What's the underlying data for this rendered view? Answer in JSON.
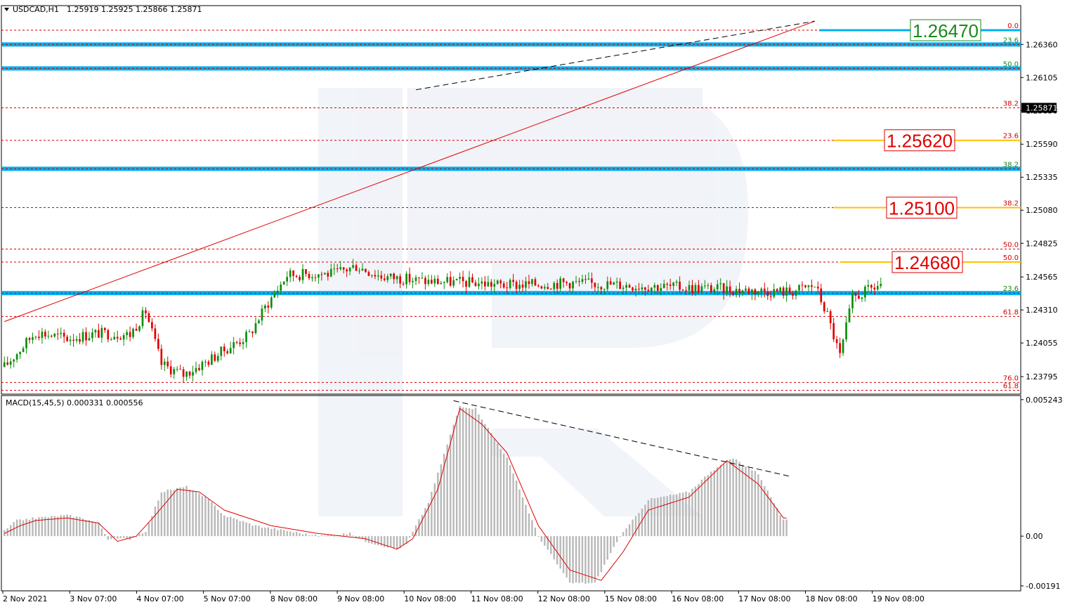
{
  "header": {
    "symbol": "USDCAD,H1",
    "ohlc": "1.25919 1.25925 1.25866 1.25871",
    "macd": "MACD(15,45,5) 0.000331 0.000556"
  },
  "colors": {
    "bull": "#0a8f0a",
    "bear": "#e00000",
    "support_band": "#00b0f0",
    "fib_line": "#d40000",
    "target_line": "#ffc000",
    "trend_red": "#e00000",
    "macd_hist": "#b8b8b8",
    "macd_signal": "#e00000"
  },
  "chart_data": [
    {
      "type": "candlestick",
      "title": "USDCAD,H1",
      "ylim": [
        1.2366,
        1.2666
      ],
      "y_ticks": [
        "1.26360",
        "1.26105",
        "1.25850",
        "1.25590",
        "1.25335",
        "1.25080",
        "1.24825",
        "1.24565",
        "1.24310",
        "1.24055",
        "1.23795"
      ],
      "last_price": "1.25871",
      "bars_total": 280,
      "close_path": [
        [
          0,
          1.2387
        ],
        [
          10,
          1.2414
        ],
        [
          20,
          1.2409
        ],
        [
          30,
          1.2413
        ],
        [
          40,
          1.2412
        ],
        [
          45,
          1.243
        ],
        [
          50,
          1.2389
        ],
        [
          57,
          1.2381
        ],
        [
          65,
          1.2392
        ],
        [
          70,
          1.24
        ],
        [
          78,
          1.2412
        ],
        [
          83,
          1.2433
        ],
        [
          90,
          1.2458
        ],
        [
          97,
          1.2459
        ],
        [
          105,
          1.2459
        ],
        [
          112,
          1.2465
        ],
        [
          120,
          1.2457
        ],
        [
          135,
          1.2453
        ],
        [
          150,
          1.2452
        ],
        [
          160,
          1.245
        ],
        [
          180,
          1.2452
        ],
        [
          200,
          1.245
        ],
        [
          220,
          1.2448
        ],
        [
          230,
          1.2447
        ],
        [
          250,
          1.2445
        ],
        [
          258,
          1.245
        ],
        [
          262,
          1.2427
        ],
        [
          266,
          1.2395
        ],
        [
          270,
          1.244
        ],
        [
          280,
          1.2452
        ]
      ],
      "levels": [
        {
          "label": "0.0",
          "value": 1.2647,
          "color": "red"
        },
        {
          "label": "23.6",
          "value": 1.2636,
          "color": "green",
          "band": true
        },
        {
          "label": "50.0",
          "value": 1.26175,
          "color": "green",
          "band": true
        },
        {
          "label": "38.2",
          "value": 1.25871,
          "color": "red"
        },
        {
          "label": "23.6",
          "value": 1.2562,
          "color": "red"
        },
        {
          "label": "38.2",
          "value": 1.254,
          "color": "green",
          "band": true
        },
        {
          "label": "38.2",
          "value": 1.251,
          "color": "red"
        },
        {
          "label": "50.0",
          "value": 1.2478,
          "color": "red"
        },
        {
          "label": "50.0",
          "value": 1.2468,
          "color": "red"
        },
        {
          "label": "23.6",
          "value": 1.2444,
          "color": "green",
          "band": true
        },
        {
          "label": "61.8",
          "value": 1.2426,
          "color": "red"
        },
        {
          "label": "76.0",
          "value": 1.2375,
          "color": "red"
        },
        {
          "label": "61.8",
          "value": 1.2369,
          "color": "red"
        }
      ],
      "targets": [
        {
          "label": "1.26470",
          "value": 1.2647,
          "color": "green"
        },
        {
          "label": "1.25620",
          "value": 1.2562,
          "color": "red"
        },
        {
          "label": "1.25100",
          "value": 1.251,
          "color": "red"
        },
        {
          "label": "1.24680",
          "value": 1.2468,
          "color": "red"
        }
      ],
      "trend_lines": [
        {
          "from": [
            0,
            1.2422
          ],
          "to": [
            258,
            1.2654
          ],
          "style": "solid",
          "color": "red"
        },
        {
          "from": [
            131,
            1.2601
          ],
          "to": [
            258,
            1.2654
          ],
          "style": "dashed",
          "color": "black"
        }
      ]
    },
    {
      "type": "histogram",
      "title": "MACD(15,45,5)",
      "ylim": [
        -0.0021,
        0.0054
      ],
      "y_ticks": [
        "0.005243",
        "0.00",
        "-0.00191"
      ],
      "hist_path": [
        [
          0,
          0.0002
        ],
        [
          4,
          0.0006
        ],
        [
          10,
          0.0007
        ],
        [
          20,
          0.0008
        ],
        [
          25,
          0.0007
        ],
        [
          30,
          0.0005
        ],
        [
          33,
          -0.0001
        ],
        [
          40,
          -0.0001
        ],
        [
          45,
          0.0002
        ],
        [
          50,
          0.0017
        ],
        [
          58,
          0.0019
        ],
        [
          65,
          0.0014
        ],
        [
          70,
          0.0008
        ],
        [
          80,
          0.0004
        ],
        [
          90,
          0.0002
        ],
        [
          100,
          0.0
        ],
        [
          110,
          0.0001
        ],
        [
          115,
          -0.0002
        ],
        [
          125,
          -0.0005
        ],
        [
          128,
          -0.0003
        ],
        [
          135,
          0.0013
        ],
        [
          145,
          0.005
        ],
        [
          150,
          0.0049
        ],
        [
          160,
          0.003
        ],
        [
          170,
          0.0
        ],
        [
          180,
          -0.0018
        ],
        [
          188,
          -0.0018
        ],
        [
          195,
          -0.0002
        ],
        [
          205,
          0.0014
        ],
        [
          218,
          0.0017
        ],
        [
          225,
          0.0025
        ],
        [
          232,
          0.003
        ],
        [
          240,
          0.0024
        ],
        [
          248,
          0.0006
        ]
      ],
      "signal_path": [
        [
          0,
          0.0001
        ],
        [
          5,
          0.0004
        ],
        [
          10,
          0.0006
        ],
        [
          20,
          0.0007
        ],
        [
          30,
          0.0005
        ],
        [
          36,
          -0.0002
        ],
        [
          42,
          0.0
        ],
        [
          48,
          0.0008
        ],
        [
          55,
          0.0018
        ],
        [
          62,
          0.0017
        ],
        [
          70,
          0.001
        ],
        [
          85,
          0.0004
        ],
        [
          100,
          0.0001
        ],
        [
          115,
          -0.0001
        ],
        [
          125,
          -0.0005
        ],
        [
          130,
          -0.0001
        ],
        [
          138,
          0.0018
        ],
        [
          145,
          0.0049
        ],
        [
          152,
          0.0043
        ],
        [
          160,
          0.0032
        ],
        [
          170,
          0.0004
        ],
        [
          180,
          -0.0013
        ],
        [
          190,
          -0.0017
        ],
        [
          197,
          -0.0006
        ],
        [
          205,
          0.001
        ],
        [
          218,
          0.0015
        ],
        [
          230,
          0.0029
        ],
        [
          240,
          0.002
        ],
        [
          248,
          0.0007
        ]
      ],
      "trend_lines": [
        {
          "from": [
            143,
            0.0052
          ],
          "to": [
            250,
            0.0023
          ],
          "style": "dashed",
          "color": "black"
        }
      ],
      "x_labels": [
        "2 Nov 2021",
        "3 Nov 07:00",
        "4 Nov 07:00",
        "5 Nov 07:00",
        "8 Nov 08:00",
        "9 Nov 08:00",
        "10 Nov 08:00",
        "11 Nov 08:00",
        "12 Nov 08:00",
        "15 Nov 08:00",
        "16 Nov 08:00",
        "17 Nov 08:00",
        "18 Nov 08:00",
        "19 Nov 08:00"
      ]
    }
  ]
}
